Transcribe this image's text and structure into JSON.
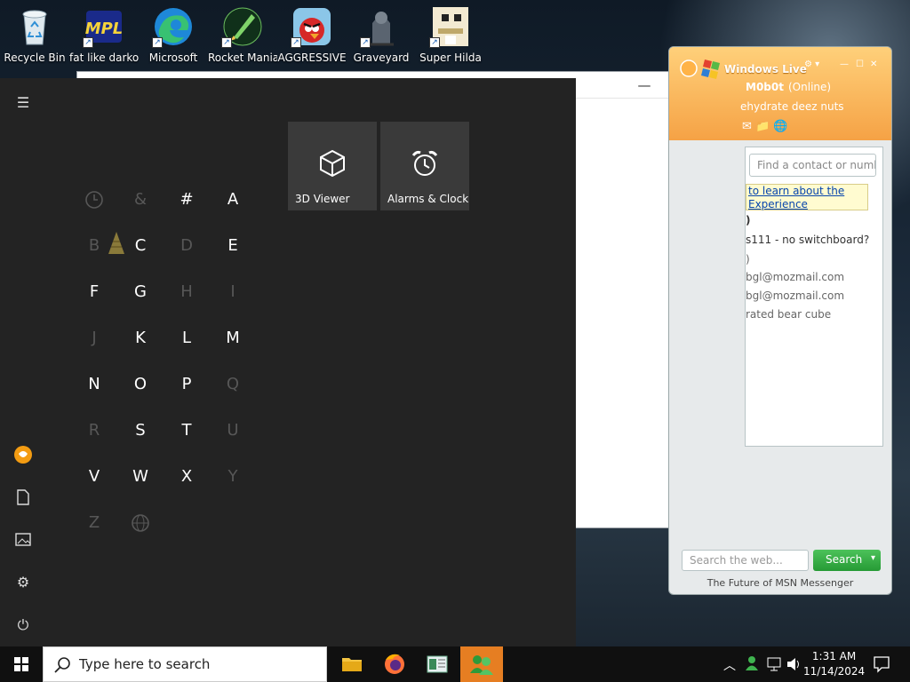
{
  "desktop": {
    "icons": [
      {
        "label": "Recycle Bin",
        "icon": "recycle-bin-icon"
      },
      {
        "label": "fat like darkok",
        "icon": "mpl-icon"
      },
      {
        "label": "Microsoft",
        "icon": "edge-icon"
      },
      {
        "label": "Rocket Mania",
        "icon": "rocket-mania-icon"
      },
      {
        "label": "AGGRESSIVE",
        "icon": "angry-bird-icon"
      },
      {
        "label": "Graveyard",
        "icon": "graveyard-icon"
      },
      {
        "label": "Super Hilda",
        "icon": "super-hilda-icon"
      }
    ]
  },
  "background_window": {
    "minimize": "—",
    "maximize": "☐",
    "close": "✕"
  },
  "messenger": {
    "title": "Windows Live",
    "name": "M0b0t",
    "status": "(Online)",
    "personal_message": "ehydrate deez nuts",
    "find_placeholder": "Find a contact or numbe",
    "notice_line1": "to learn about the",
    "notice_line2": "Experience",
    "rows": [
      {
        "text": ")",
        "bold": true
      },
      {
        "text": "s111 - no switchboard?",
        "bold": false
      },
      {
        "text": ")",
        "bold": false
      },
      {
        "text": "bgl@mozmail.com",
        "bold": false
      },
      {
        "text": "bgl@mozmail.com",
        "bold": false
      },
      {
        "text": "rated bear cube",
        "bold": false
      }
    ],
    "web_search_placeholder": "Search the web...",
    "search_button": "Search",
    "footer": "The Future of MSN Messenger"
  },
  "start_menu": {
    "letters": [
      {
        "char": "",
        "enabled": false,
        "icon": "clock-icon"
      },
      {
        "char": "&",
        "enabled": false
      },
      {
        "char": "#",
        "enabled": true
      },
      {
        "char": "A",
        "enabled": true
      },
      {
        "char": "B",
        "enabled": false
      },
      {
        "char": "C",
        "enabled": true
      },
      {
        "char": "D",
        "enabled": false
      },
      {
        "char": "E",
        "enabled": true
      },
      {
        "char": "F",
        "enabled": true
      },
      {
        "char": "G",
        "enabled": true
      },
      {
        "char": "H",
        "enabled": false
      },
      {
        "char": "I",
        "enabled": false
      },
      {
        "char": "J",
        "enabled": false
      },
      {
        "char": "K",
        "enabled": true
      },
      {
        "char": "L",
        "enabled": true
      },
      {
        "char": "M",
        "enabled": true
      },
      {
        "char": "N",
        "enabled": true
      },
      {
        "char": "O",
        "enabled": true
      },
      {
        "char": "P",
        "enabled": true
      },
      {
        "char": "Q",
        "enabled": false
      },
      {
        "char": "R",
        "enabled": false
      },
      {
        "char": "S",
        "enabled": true
      },
      {
        "char": "T",
        "enabled": true
      },
      {
        "char": "U",
        "enabled": false
      },
      {
        "char": "V",
        "enabled": true
      },
      {
        "char": "W",
        "enabled": true
      },
      {
        "char": "X",
        "enabled": true
      },
      {
        "char": "Y",
        "enabled": false
      },
      {
        "char": "Z",
        "enabled": false
      },
      {
        "char": "",
        "enabled": false,
        "icon": "globe-icon"
      }
    ],
    "tiles": [
      {
        "label": "3D Viewer",
        "icon": "cube-icon"
      },
      {
        "label": "Alarms & Clock",
        "icon": "alarm-clock-icon"
      }
    ]
  },
  "taskbar": {
    "search_placeholder": "Type here to search",
    "time": "1:31 AM",
    "date": "11/14/2024"
  }
}
